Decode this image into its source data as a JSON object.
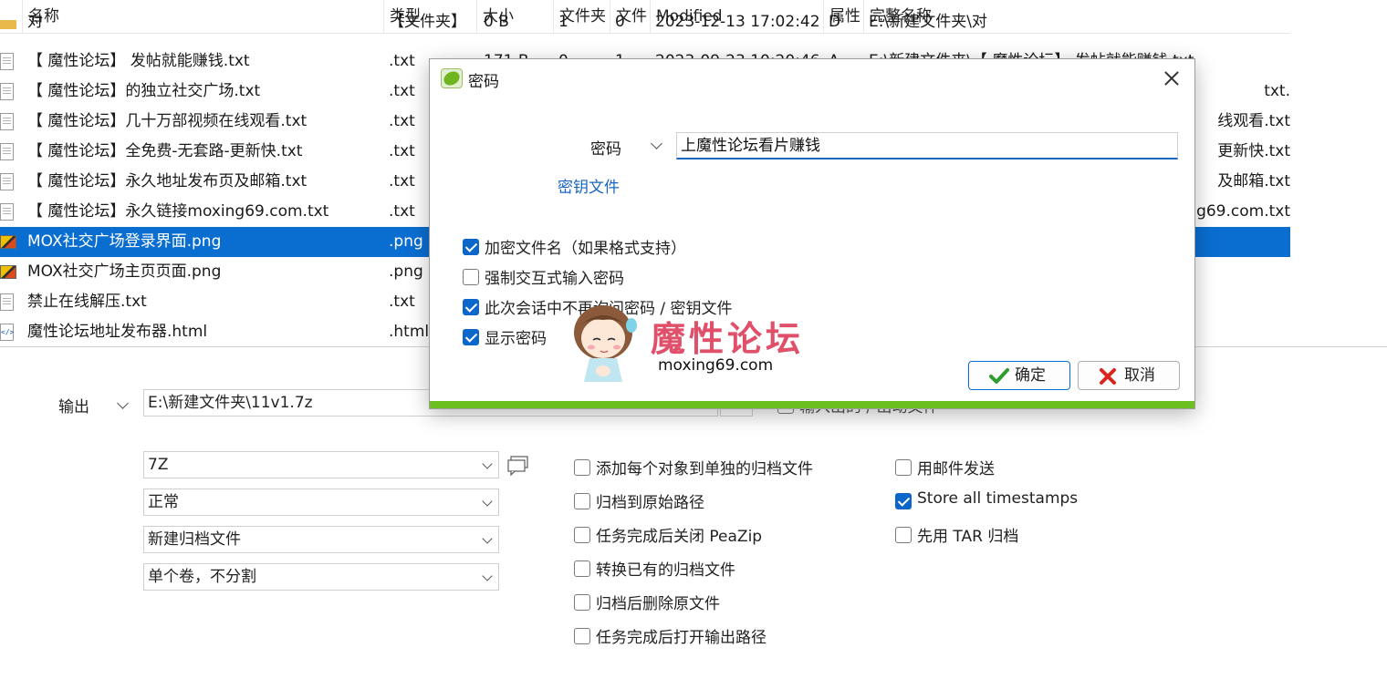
{
  "columns": {
    "name": "名称",
    "type": "类型",
    "size": "大小",
    "folders": "文件夹",
    "files": "文件",
    "modified": "Modified",
    "attr": "属性",
    "fullname": "完整名称"
  },
  "rows": [
    {
      "name": "对",
      "type": "【文件夹】",
      "size": "0 B",
      "folders": "1",
      "files": "0",
      "modified": "2023-12-13 17:02:42",
      "attr": "D",
      "fullname": "E:\\新建文件夹\\对",
      "icon": "folder-icon"
    },
    {
      "name": "【 魔性论坛】 发帖就能赚钱.txt",
      "type": ".txt",
      "size": "171 B",
      "folders": "0",
      "files": "1",
      "modified": "2023-09-23 10:20:46",
      "attr": "A",
      "fullname": "E:\\新建文件夹\\【 魔性论坛】 发帖就能赚钱.txt",
      "icon": "text-file-icon"
    },
    {
      "name": "【 魔性论坛】的独立社交广场.txt",
      "type": ".txt",
      "fullname_tail": ".txt",
      "icon": "text-file-icon"
    },
    {
      "name": "【 魔性论坛】几十万部视频在线观看.txt",
      "type": ".txt",
      "fullname_tail": "线观看.txt",
      "icon": "text-file-icon"
    },
    {
      "name": "【 魔性论坛】全免费-无套路-更新快.txt",
      "type": ".txt",
      "fullname_tail": "更新快.txt",
      "icon": "text-file-icon"
    },
    {
      "name": "【 魔性论坛】永久地址发布页及邮箱.txt",
      "type": ".txt",
      "fullname_tail": "及邮箱.txt",
      "icon": "text-file-icon"
    },
    {
      "name": "【 魔性论坛】永久链接moxing69.com.txt",
      "type": ".txt",
      "fullname_tail": "g69.com.txt",
      "icon": "text-file-icon"
    },
    {
      "name": "MOX社交广场登录界面.png",
      "type": ".png",
      "fullname_tail": "",
      "icon": "image-file-icon",
      "selected": true
    },
    {
      "name": "MOX社交广场主页页面.png",
      "type": ".png",
      "fullname_tail": "",
      "icon": "image-file-icon"
    },
    {
      "name": "禁止在线解压.txt",
      "type": ".txt",
      "fullname_tail": "",
      "icon": "text-file-icon"
    },
    {
      "name": "魔性论坛地址发布器.html",
      "type": ".html",
      "fullname_tail": "",
      "icon": "html-file-icon"
    }
  ],
  "output": {
    "label": "输出",
    "path": "E:\\新建文件夹\\11v1.7z",
    "browse": "...",
    "overlap_label": "输入出的 / 出动文件"
  },
  "combos": {
    "format": "7Z",
    "level": "正常",
    "mode": "新建归档文件",
    "volume": "单个卷，不分割"
  },
  "options_col1": [
    {
      "label": "添加每个对象到单独的归档文件",
      "checked": false
    },
    {
      "label": "归档到原始路径",
      "checked": false
    },
    {
      "label": "任务完成后关闭 PeaZip",
      "checked": false
    },
    {
      "label": "转换已有的归档文件",
      "checked": false
    },
    {
      "label": "归档后删除原文件",
      "checked": false
    },
    {
      "label": "任务完成后打开输出路径",
      "checked": false
    }
  ],
  "options_col2": [
    {
      "label": "用邮件发送",
      "checked": false
    },
    {
      "label": "Store all timestamps",
      "checked": true
    },
    {
      "label": "先用 TAR 归档",
      "checked": false
    }
  ],
  "dialog": {
    "title": "密码",
    "password_label": "密码",
    "password_value": "上魔性论坛看片赚钱",
    "keyfile_link": "密钥文件",
    "checks": [
      {
        "label": "加密文件名（如果格式支持）",
        "checked": true
      },
      {
        "label": "强制交互式输入密码",
        "checked": false
      },
      {
        "label": "此次会话中不再询问密码 / 密钥文件",
        "checked": true
      },
      {
        "label": "显示密码",
        "checked": true
      }
    ],
    "ok": "确定",
    "cancel": "取消"
  },
  "watermark": {
    "text": "魔性论坛",
    "url": "moxing69.com"
  },
  "colors": {
    "selection": "#0a6ed1",
    "accent_green": "#6bbf1e",
    "checkbox_blue": "#0a66c8",
    "cancel_red": "#d9261c",
    "ok_green": "#2e9c2e"
  }
}
